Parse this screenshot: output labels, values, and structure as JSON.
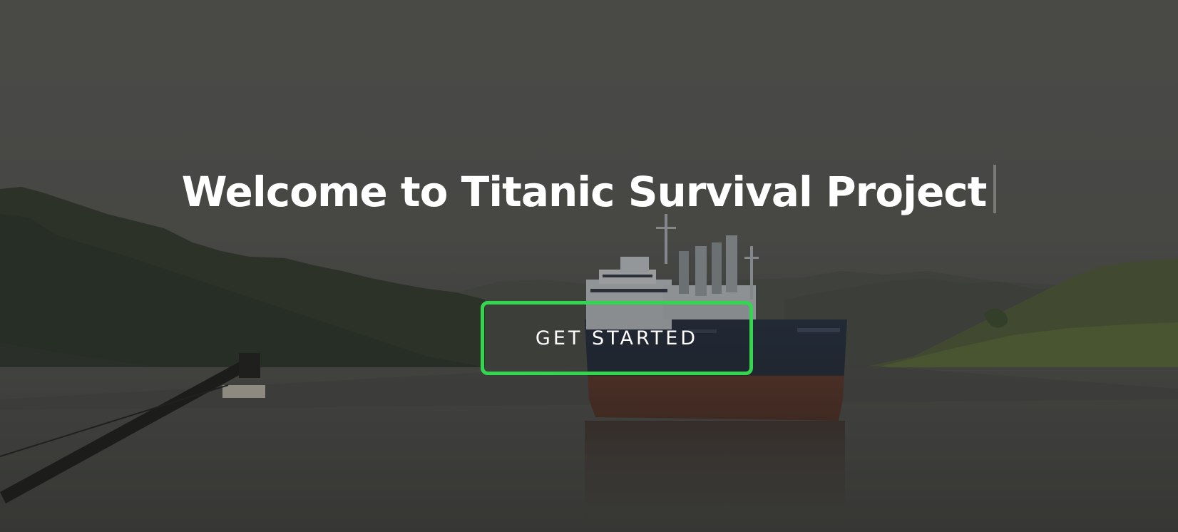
{
  "hero": {
    "title": "Welcome to Titanic Survival Project",
    "cta_label": "GET STARTED",
    "accent_color": "#35d64f",
    "background_photo": "cargo ship in a misty river canal with forested banks"
  }
}
